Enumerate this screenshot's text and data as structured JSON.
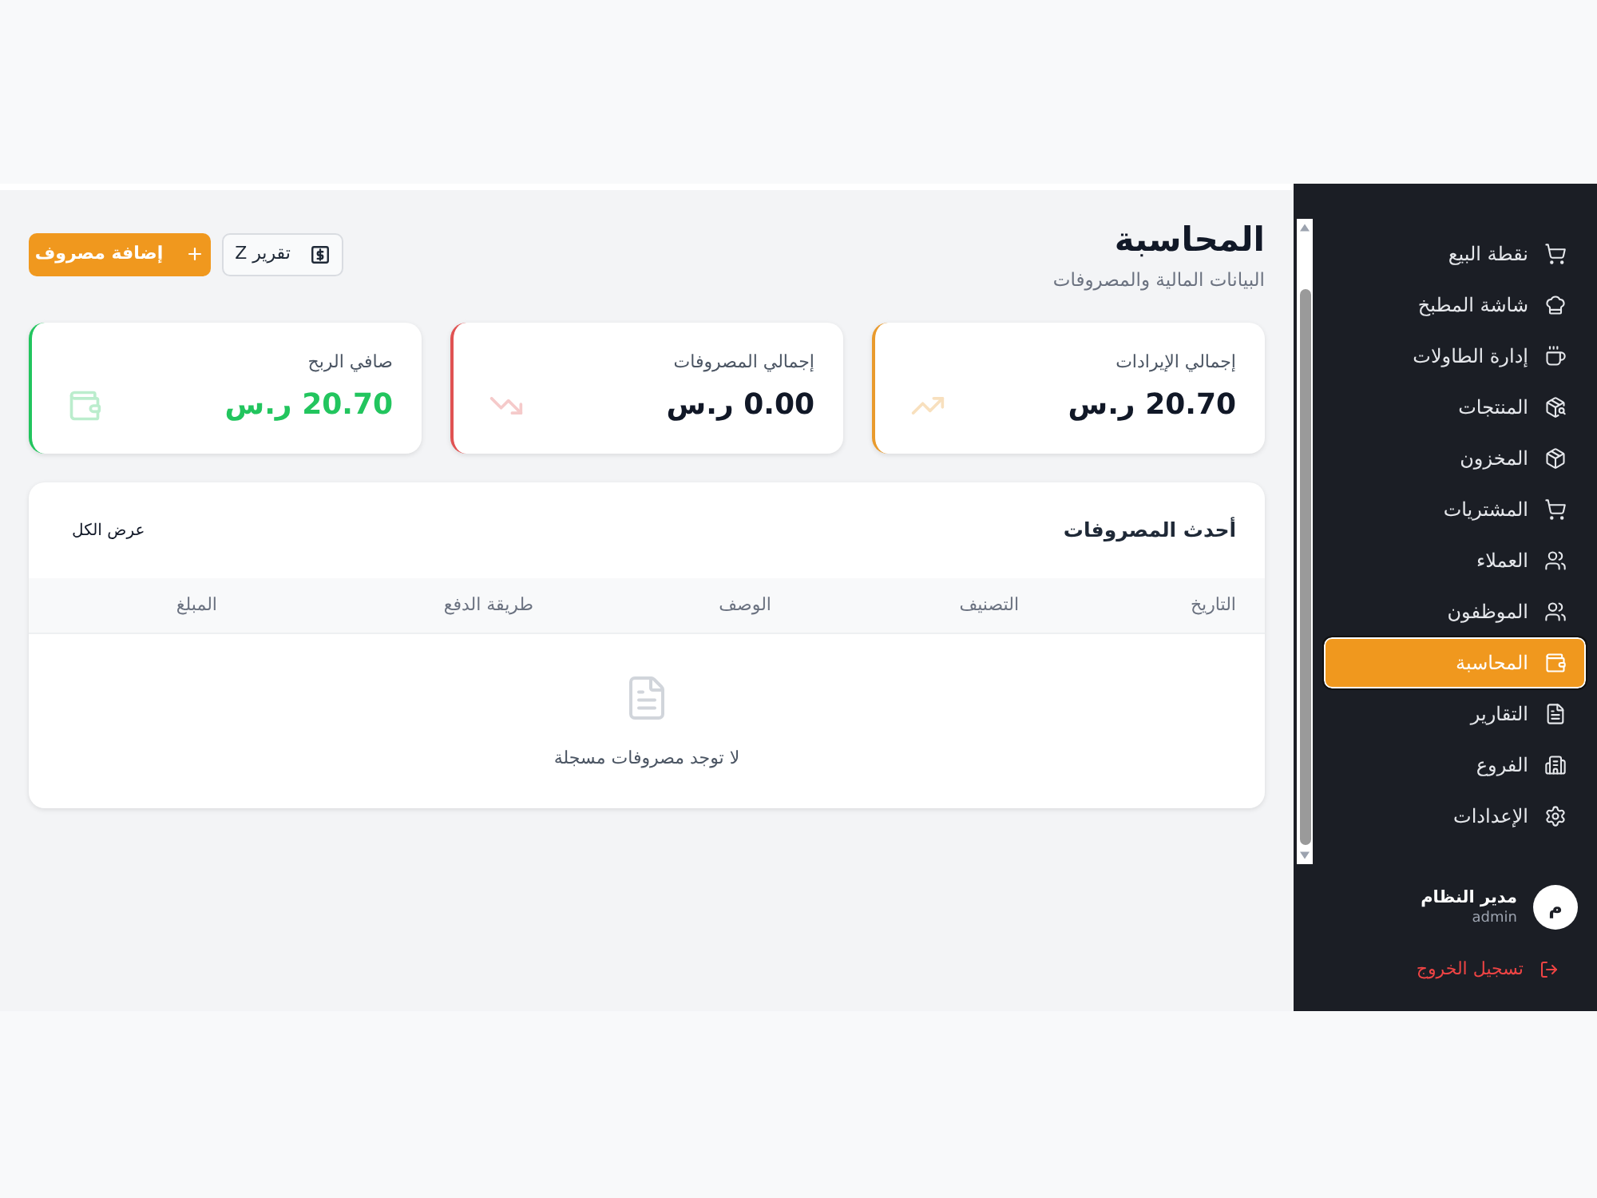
{
  "sidebar": {
    "items": [
      {
        "label": "نقطة البيع",
        "selected": false
      },
      {
        "label": "شاشة المطبخ",
        "selected": false
      },
      {
        "label": "إدارة الطاولات",
        "selected": false
      },
      {
        "label": "المنتجات",
        "selected": false
      },
      {
        "label": "المخزون",
        "selected": false
      },
      {
        "label": "المشتريات",
        "selected": false
      },
      {
        "label": "العملاء",
        "selected": false
      },
      {
        "label": "الموظفون",
        "selected": false
      },
      {
        "label": "المحاسبة",
        "selected": true
      },
      {
        "label": "التقارير",
        "selected": false
      },
      {
        "label": "الفروع",
        "selected": false
      },
      {
        "label": "الإعدادات",
        "selected": false
      }
    ],
    "user": {
      "initial": "م",
      "name": "مدير النظام",
      "role": "admin"
    },
    "logout": "تسجيل الخروج"
  },
  "header": {
    "title": "المحاسبة",
    "subtitle": "البيانات المالية والمصروفات"
  },
  "actions": [
    {
      "kind": "secondary",
      "label": "تقرير Z"
    },
    {
      "kind": "primary",
      "label": "إضافة مصروف"
    }
  ],
  "stats": [
    {
      "label": "إجمالي الإيرادات",
      "value": "20.70 ر.س",
      "color": "#e99a2c",
      "highlight": false
    },
    {
      "label": "إجمالي المصروفات",
      "value": "0.00 ر.س",
      "color": "#e05252",
      "highlight": false
    },
    {
      "label": "صافي الربح",
      "value": "20.70 ر.س",
      "color": "#22c55e",
      "highlight": true
    }
  ],
  "expenses": {
    "title": "أحدث المصروفات",
    "view_all": "عرض الكل",
    "columns": [
      "التاريخ",
      "التصنيف",
      "الوصف",
      "طريقة الدفع",
      "المبلغ"
    ],
    "empty_message": "لا توجد مصروفات مسجلة"
  }
}
